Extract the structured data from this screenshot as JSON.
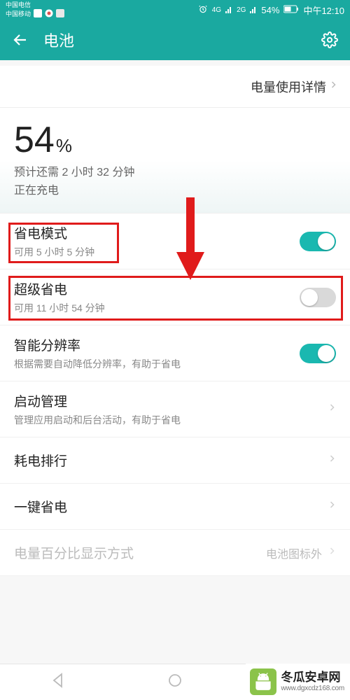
{
  "status": {
    "carrier1": "中国电信",
    "carrier2": "中国移动",
    "alarm_icon": "⏰",
    "signal1": "4G",
    "signal2": "2G",
    "battery_pct": "54%",
    "time": "中午12:10"
  },
  "appbar": {
    "title": "电池"
  },
  "usage_link": {
    "label": "电量使用详情"
  },
  "hero": {
    "percent": "54",
    "unit": "%",
    "estimate": "预计还需 2 小时 32 分钟",
    "charging": "正在充电"
  },
  "rows": {
    "power_save": {
      "title": "省电模式",
      "sub": "可用 5 小时 5 分钟",
      "on": true
    },
    "ultra_save": {
      "title": "超级省电",
      "sub": "可用 11 小时 54 分钟",
      "on": false
    },
    "smart_res": {
      "title": "智能分辨率",
      "sub": "根据需要自动降低分辨率，有助于省电",
      "on": true
    },
    "launch": {
      "title": "启动管理",
      "sub": "管理应用启动和后台活动，有助于省电"
    },
    "usage_rank": {
      "title": "耗电排行"
    },
    "one_key": {
      "title": "一键省电"
    },
    "pct_mode": {
      "title": "电量百分比显示方式",
      "value": "电池图标外"
    }
  },
  "watermark": {
    "brand": "冬瓜安卓网",
    "url": "www.dgxcdz168.com"
  },
  "colors": {
    "accent": "#1aa9a0",
    "annotation": "#e01b1b"
  }
}
